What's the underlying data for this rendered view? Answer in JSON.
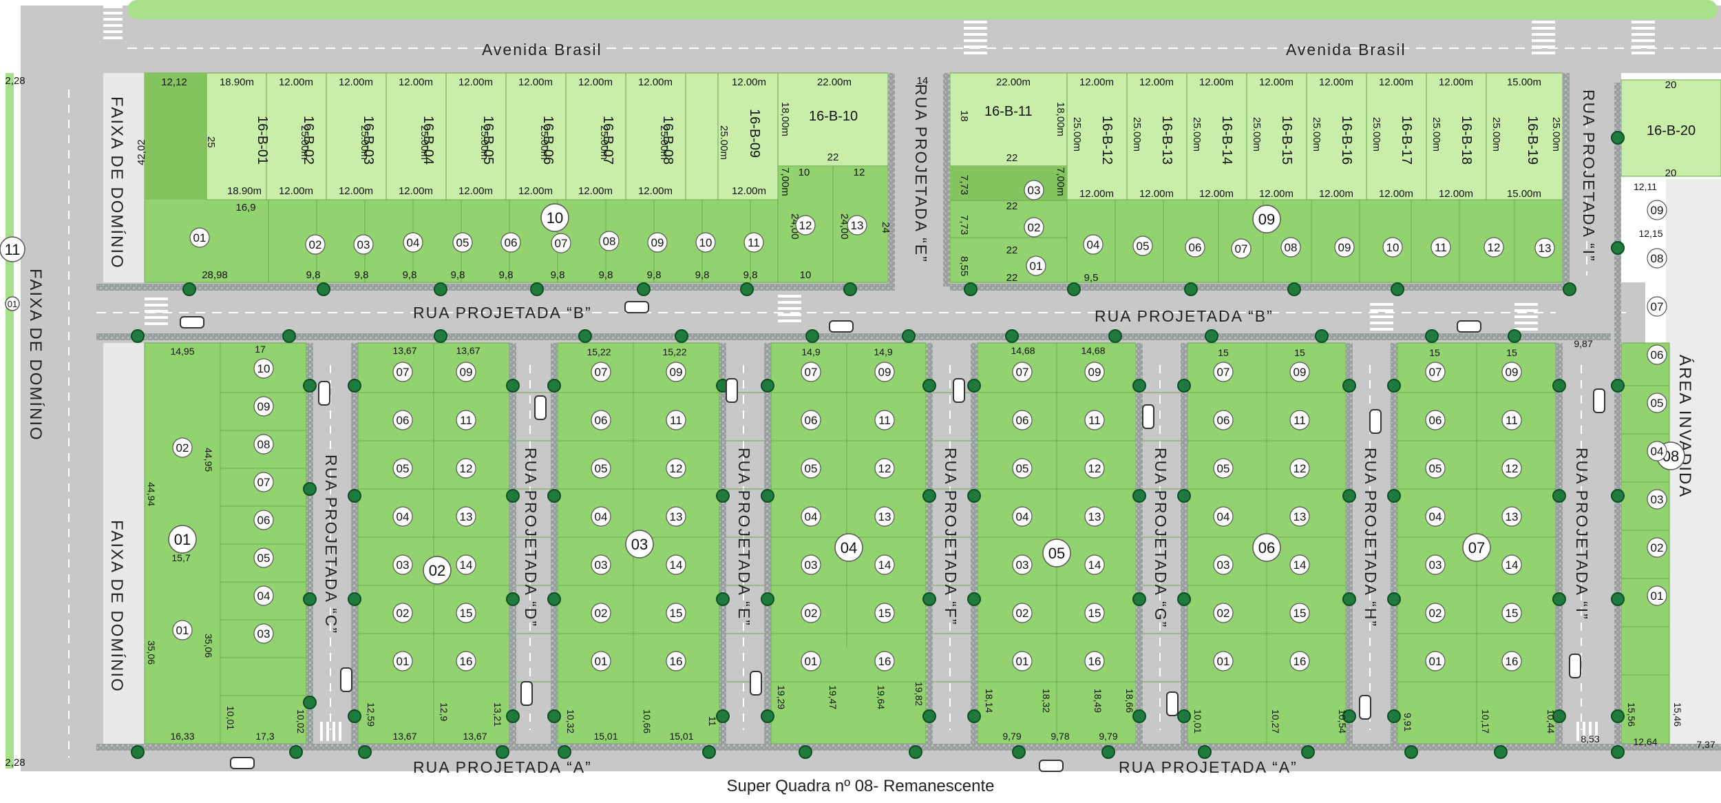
{
  "caption": "Super Quadra nº 08- Remanescente",
  "colors": {
    "lot_light": "#c9eeaa",
    "lot": "#93d36f",
    "lot_dark": "#84c45f",
    "road": "#c8c8c9",
    "tree": "#1f7a3d",
    "strip": "#a8e08c"
  },
  "roads": {
    "avenida": "Avenida Brasil",
    "rua_b": "RUA PROJETADA “B”",
    "rua_a": "RUA PROJETADA “A”",
    "rua_e_top": "RUA PROJETADA “E”",
    "rua_i_top": "RUA PROJETADA “I”",
    "vertical": [
      "RUA PROJETADA “C”",
      "RUA PROJETADA “D”",
      "RUA PROJETADA “E”",
      "RUA PROJETADA “F”",
      "RUA PROJETADA “G”",
      "RUA PROJETADA “H”",
      "RUA PROJETADA “I”"
    ]
  },
  "side_labels": {
    "faixa_dominio": "FAIXA DE DOMÍNIO",
    "area_invadida": "ÁREA INVADIDA"
  },
  "block_numbers": [
    "11",
    "01",
    "10",
    "09",
    "01",
    "02",
    "03",
    "04",
    "05",
    "06",
    "07",
    "08"
  ],
  "lots": {
    "b_top_left": [
      "16-B-01",
      "16-B-02",
      "16-B-03",
      "16-B-04",
      "16-B-05",
      "16-B-06",
      "16-B-07",
      "16-B-08",
      "16-B-09",
      "16-B-10"
    ],
    "b_top_right": [
      "16-B-11",
      "16-B-12",
      "16-B-13",
      "16-B-14",
      "16-B-15",
      "16-B-16",
      "16-B-17",
      "16-B-18",
      "16-B-19",
      "16-B-20"
    ],
    "row10": [
      "02",
      "03",
      "04",
      "05",
      "06",
      "07",
      "08",
      "09",
      "10",
      "11",
      "12",
      "13"
    ],
    "row09": [
      "03",
      "02",
      "01",
      "04",
      "05",
      "06",
      "07",
      "08",
      "09",
      "10",
      "11",
      "12",
      "13"
    ],
    "col_lots": [
      "10",
      "09",
      "08",
      "07",
      "06",
      "05",
      "04",
      "03",
      "02",
      "01",
      "11",
      "12",
      "13",
      "14",
      "15",
      "16"
    ]
  },
  "dims": {
    "w1890": "18.90m",
    "w1200": "12.00m",
    "w2200": "22.00m",
    "w1500": "15.00m",
    "d2500": "25.00m",
    "d1800": "18,00m",
    "d700": "7,00m",
    "n1212": "12,12",
    "n169": "16,9",
    "n4202": "42,02",
    "n2898": "28,98",
    "n98": "9,8",
    "n95": "9,5",
    "n17": "17",
    "n25": "25",
    "n22": "22",
    "n20": "20",
    "n24": "24",
    "n2400": "24,00",
    "n10": "10",
    "n12": "12",
    "n14": "14",
    "n7": "7",
    "n18": "18",
    "n773": "7,73",
    "n855": "8,55",
    "n228": "2,28",
    "n1495": "14,95",
    "n4494": "44,94",
    "n4495": "44,95",
    "n157": "15,7",
    "n3506": "35,06",
    "n1633": "16,33",
    "n1367": "13,67",
    "n1522": "15,22",
    "n149": "14,9",
    "n1468": "14,68",
    "n15": "15",
    "n987": "9,87",
    "n737": "7,37",
    "n1264": "12,64",
    "n1211": "12,11",
    "n1215": "12,15",
    "n853": "8,53",
    "n1001": "10,01",
    "n1002": "10,02",
    "n173": "17,3",
    "n1259": "12,59",
    "n129": "12,9",
    "n1321": "13,21",
    "n1032": "10,32",
    "n1501": "15,01",
    "n1066": "10,66",
    "n11": "11",
    "n1929": "19,29",
    "n1947": "19,47",
    "n1964": "19,64",
    "n1982": "19,82",
    "n1814": "18,14",
    "n1832": "18,32",
    "n1849": "18,49",
    "n1866": "18,66",
    "n979": "9,79",
    "n978": "9,78",
    "n1027": "10,27",
    "n1054": "10,54",
    "n991": "9,91",
    "n1017": "10,17",
    "n1044": "10,44",
    "n1556": "15,56",
    "n1546": "15,46"
  }
}
